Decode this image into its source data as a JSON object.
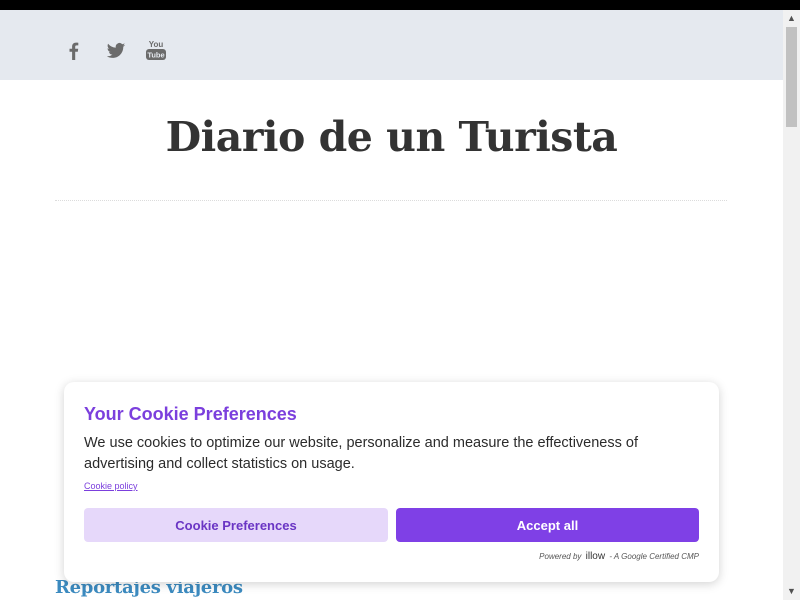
{
  "social": {
    "icons": [
      "facebook-icon",
      "twitter-icon",
      "youtube-icon"
    ],
    "youtube_text_top": "You",
    "youtube_text_bottom": "Tube"
  },
  "site": {
    "title": "Diario de un Turista"
  },
  "section": {
    "heading": "Reportajes viajeros"
  },
  "cookie": {
    "title": "Your Cookie Preferences",
    "text": "We use cookies to optimize our website, personalize and measure the effectiveness of advertising and collect statistics on usage.",
    "policy_link": "Cookie policy",
    "preferences_button": "Cookie Preferences",
    "accept_button": "Accept all",
    "powered_prefix": "Powered by",
    "powered_brand": "illow",
    "powered_suffix": "- A Google Certified CMP"
  },
  "colors": {
    "accent": "#7f40e6",
    "accent_light": "#e6d8fa",
    "link_blue": "#3c8bc0",
    "social_bar_bg": "#e5e9ef"
  }
}
